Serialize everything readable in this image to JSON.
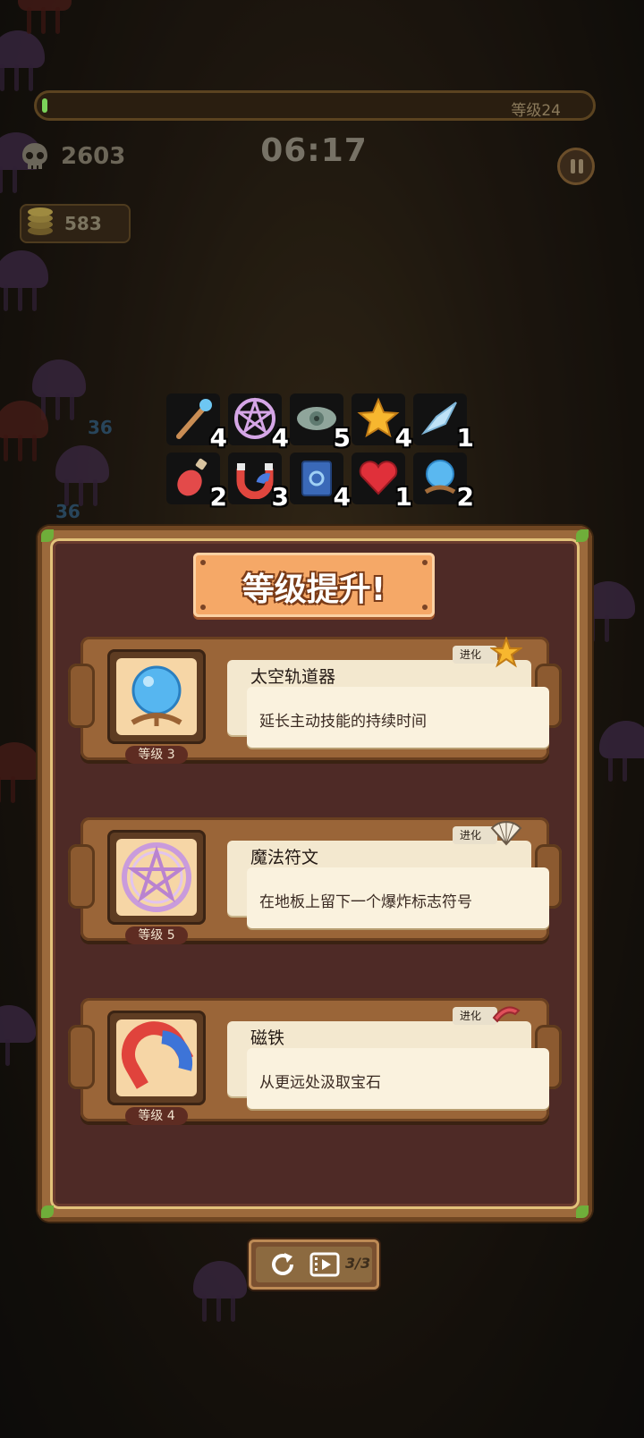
{
  "hud": {
    "level_label": "等级24",
    "kills": "2603",
    "timer": "06:17",
    "coins": "583",
    "float_numbers": [
      "36",
      "36"
    ]
  },
  "inventory": [
    {
      "icon": "staff-icon",
      "count": "4"
    },
    {
      "icon": "pentagram-icon",
      "count": "4"
    },
    {
      "icon": "eye-icon",
      "count": "5"
    },
    {
      "icon": "star-icon",
      "count": "4"
    },
    {
      "icon": "crystal-shard-icon",
      "count": "1"
    },
    {
      "icon": "potion-icon",
      "count": "2"
    },
    {
      "icon": "magnet-icon",
      "count": "3"
    },
    {
      "icon": "spellbook-icon",
      "count": "4"
    },
    {
      "icon": "heart-gem-icon",
      "count": "1"
    },
    {
      "icon": "crystal-ball-icon",
      "count": "2"
    }
  ],
  "panel": {
    "title": "等级提升!",
    "choices": [
      {
        "name": "太空轨道器",
        "desc": "延长主动技能的持续时间",
        "level": "等级 3",
        "tag": "进化",
        "icon": "crystal-ball-icon",
        "evolve_icon": "star-icon"
      },
      {
        "name": "魔法符文",
        "desc": "在地板上留下一个爆炸标志符号",
        "level": "等级 5",
        "tag": "进化",
        "icon": "pentagram-icon",
        "evolve_icon": "fan-icon"
      },
      {
        "name": "磁铁",
        "desc": "从更远处汲取宝石",
        "level": "等级 4",
        "tag": "进化",
        "icon": "magnet-icon",
        "evolve_icon": "boomerang-icon"
      }
    ],
    "reroll_count": "3/3"
  },
  "colors": {
    "xp": "#7bd35a",
    "panel_wood": "#9c6a3c",
    "panel_inner": "#4e2a26",
    "title_plaque": "#f5a867"
  }
}
